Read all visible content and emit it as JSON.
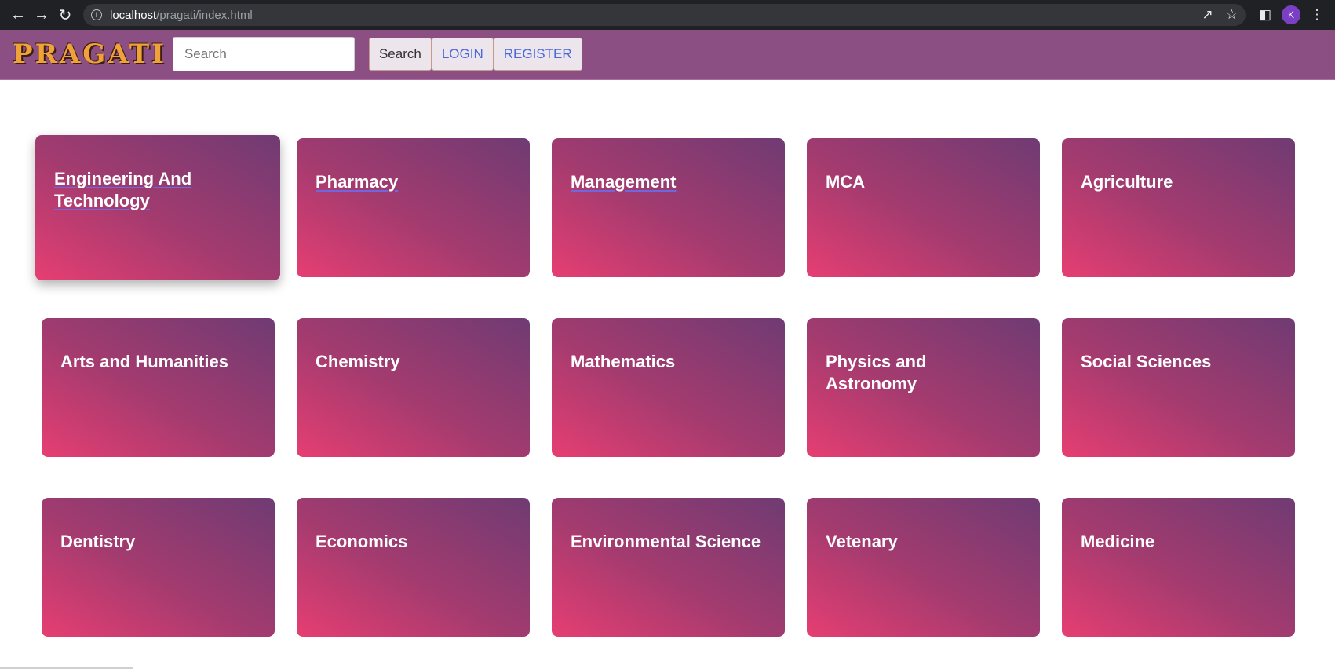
{
  "browser": {
    "url_host": "localhost",
    "url_path": "/pragati/index.html",
    "avatar_letter": "K"
  },
  "header": {
    "logo": "PRAGATI",
    "search_placeholder": "Search",
    "search_button": "Search",
    "login": "LOGIN",
    "register": "REGISTER"
  },
  "cards": [
    "Engineering And Technology",
    "Pharmacy",
    "Management",
    "MCA",
    "Agriculture",
    "Arts and Humanities",
    "Chemistry",
    "Mathematics",
    "Physics and Astronomy",
    "Social Sciences",
    "Dentistry",
    "Economics",
    "Environmental Science",
    "Vetenary",
    "Medicine"
  ],
  "colors": {
    "header_bg": "#8c4f84",
    "card_gradient_start": "#e63e72",
    "card_gradient_end": "#6f3b73",
    "logo": "#f0a23a",
    "link": "#4a68d8"
  }
}
